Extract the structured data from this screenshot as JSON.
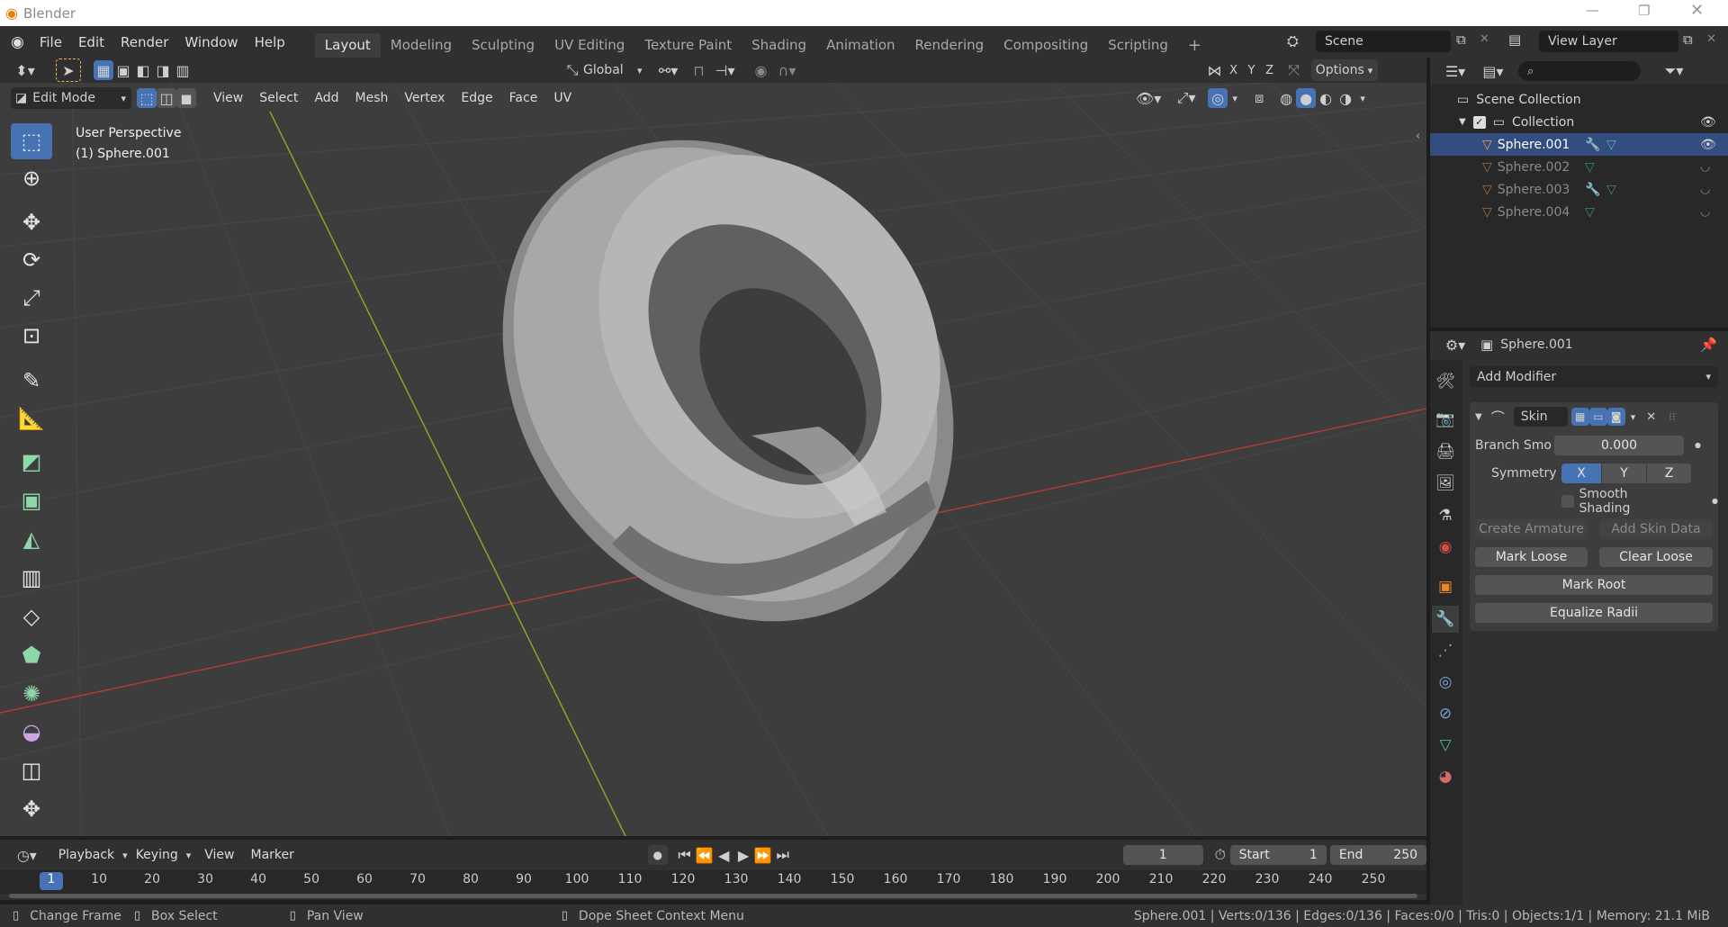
{
  "app": {
    "title": "Blender"
  },
  "menu": [
    "File",
    "Edit",
    "Render",
    "Window",
    "Help"
  ],
  "workspaces": [
    "Layout",
    "Modeling",
    "Sculpting",
    "UV Editing",
    "Texture Paint",
    "Shading",
    "Animation",
    "Rendering",
    "Compositing",
    "Scripting"
  ],
  "scene": {
    "name": "Scene",
    "view_layer": "View Layer"
  },
  "viewport": {
    "transform_orientation": "Global",
    "axes": [
      "X",
      "Y",
      "Z"
    ],
    "options_label": "Options",
    "mode": "Edit Mode",
    "header_menus": [
      "View",
      "Select",
      "Add",
      "Mesh",
      "Vertex",
      "Edge",
      "Face",
      "UV"
    ],
    "overlay_line1": "User Perspective",
    "overlay_line2": "(1) Sphere.001"
  },
  "outliner": {
    "search_placeholder": "",
    "root": "Scene Collection",
    "collection": "Collection",
    "objects": [
      "Sphere.001",
      "Sphere.002",
      "Sphere.003",
      "Sphere.004"
    ]
  },
  "properties": {
    "object_name": "Sphere.001",
    "add_modifier": "Add Modifier",
    "modifier_name": "Skin",
    "branch_label": "Branch Smo",
    "branch_value": "0.000",
    "symmetry_label": "Symmetry",
    "symmetry": [
      "X",
      "Y",
      "Z"
    ],
    "smooth_shading": "Smooth Shading",
    "create_armature": "Create Armature",
    "add_skin_data": "Add Skin Data",
    "mark_loose": "Mark Loose",
    "clear_loose": "Clear Loose",
    "mark_root": "Mark Root",
    "equalize_radii": "Equalize Radii"
  },
  "timeline": {
    "menus": [
      "Playback",
      "Keying",
      "View",
      "Marker"
    ],
    "current_frame": "1",
    "start_label": "Start",
    "start": "1",
    "end_label": "End",
    "end": "250",
    "ticks": [
      "1",
      "10",
      "20",
      "30",
      "40",
      "50",
      "60",
      "70",
      "80",
      "90",
      "100",
      "110",
      "120",
      "130",
      "140",
      "150",
      "160",
      "170",
      "180",
      "190",
      "200",
      "210",
      "220",
      "230",
      "240",
      "250"
    ]
  },
  "statusbar": {
    "change_frame": "Change Frame",
    "box_select": "Box Select",
    "pan_view": "Pan View",
    "context_menu": "Dope Sheet Context Menu",
    "stats": "Sphere.001 | Verts:0/136 | Edges:0/136 | Faces:0/0 | Tris:0 | Objects:1/1 | Memory: 21.1 MiB"
  },
  "colors": {
    "accent": "#4772b3",
    "bg": "#303030",
    "viewport": "#3d3d3d",
    "x_axis": "#b03a3a",
    "y_axis": "#86a62a"
  }
}
